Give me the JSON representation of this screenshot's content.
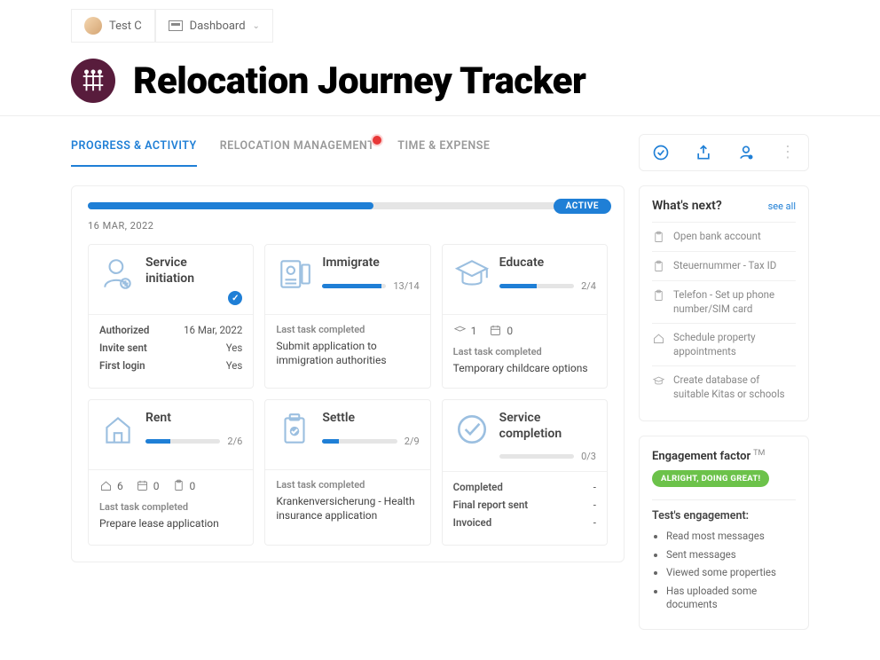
{
  "user": {
    "name": "Test C"
  },
  "nav": {
    "dashboard": "Dashboard"
  },
  "page": {
    "title": "Relocation Journey Tracker"
  },
  "tabs": {
    "progress": "PROGRESS & ACTIVITY",
    "relocation": "RELOCATION MANAGEMENT",
    "time": "TIME & EXPENSE"
  },
  "progress": {
    "percent": 55,
    "status": "ACTIVE",
    "date": "16 MAR, 2022"
  },
  "cards": {
    "service_init": {
      "title": "Service initiation",
      "rows": {
        "authorized": {
          "k": "Authorized",
          "v": "16 Mar, 2022"
        },
        "invite": {
          "k": "Invite sent",
          "v": "Yes"
        },
        "login": {
          "k": "First login",
          "v": "Yes"
        }
      }
    },
    "immigrate": {
      "title": "Immigrate",
      "progress": "13/14",
      "pct": 93,
      "last_label": "Last task completed",
      "last_text": "Submit application to immigration authorities"
    },
    "educate": {
      "title": "Educate",
      "progress": "2/4",
      "pct": 50,
      "stat1": "1",
      "stat2": "0",
      "last_label": "Last task completed",
      "last_text": "Temporary childcare options"
    },
    "rent": {
      "title": "Rent",
      "progress": "2/6",
      "pct": 33,
      "stat1": "6",
      "stat2": "0",
      "stat3": "0",
      "last_label": "Last task completed",
      "last_text": "Prepare lease application"
    },
    "settle": {
      "title": "Settle",
      "progress": "2/9",
      "pct": 22,
      "last_label": "Last task completed",
      "last_text": "Krankenversicherung - Health insurance application"
    },
    "completion": {
      "title": "Service completion",
      "progress": "0/3",
      "pct": 0,
      "rows": {
        "completed": {
          "k": "Completed",
          "v": "-"
        },
        "report": {
          "k": "Final report sent",
          "v": "-"
        },
        "invoiced": {
          "k": "Invoiced",
          "v": "-"
        }
      }
    }
  },
  "whats_next": {
    "title": "What's next?",
    "see_all": "see all",
    "items": [
      "Open bank account",
      "Steuernummer - Tax ID",
      "Telefon - Set up phone number/SIM card",
      "Schedule property appointments",
      "Create database of suitable Kitas or schools"
    ]
  },
  "engagement": {
    "label": "Engagement factor",
    "tm": "TM",
    "pill": "ALRIGHT, DOING GREAT!",
    "sub": "Test's engagement:",
    "items": [
      "Read most messages",
      "Sent messages",
      "Viewed some properties",
      "Has uploaded some documents"
    ]
  }
}
